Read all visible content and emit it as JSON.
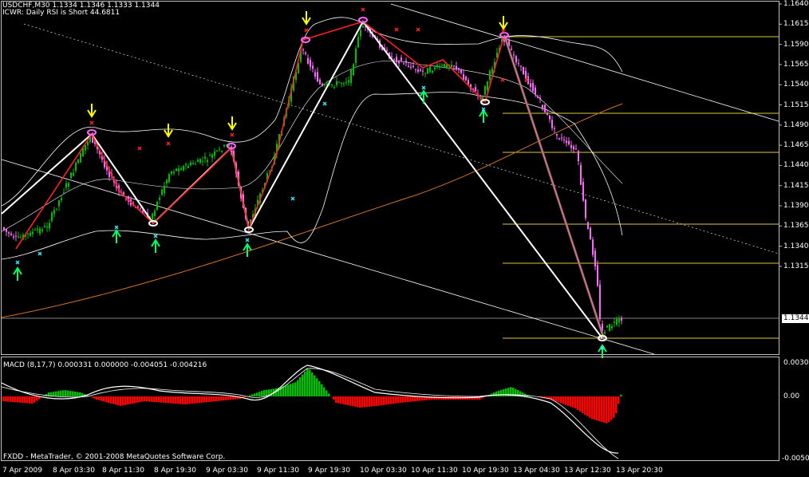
{
  "header": {
    "symbol_line": "USDCHF,M30  1.1334 1.1346 1.1333 1.1344",
    "indicator_line": "ICWR: Daily RSI is Short 44.6811"
  },
  "macd": {
    "label": "MACD  (8,17,7) 0.000331 0.000000 -0.004051 -0.004216",
    "axis": [
      "0.003036",
      "0.00",
      "-0.005087"
    ]
  },
  "footer": {
    "copyright": "FXDD - MetaTrader, © 2001-2008 MetaQuotes Software Corp."
  },
  "price_axis": [
    "1.1640",
    "1.1615",
    "1.1590",
    "1.1565",
    "1.1540",
    "1.1515",
    "1.1490",
    "1.1465",
    "1.1440",
    "1.1415",
    "1.1390",
    "1.1365",
    "1.1340",
    "1.1315"
  ],
  "current_price": "1.1344",
  "time_axis": [
    "7 Apr 2009",
    "8 Apr 03:30",
    "8 Apr 11:30",
    "8 Apr 19:30",
    "9 Apr 03:30",
    "9 Apr 11:30",
    "9 Apr 19:30",
    "10 Apr 03:30",
    "10 Apr 11:30",
    "10 Apr 19:30",
    "13 Apr 04:30",
    "13 Apr 12:30",
    "13 Apr 20:30"
  ],
  "colors": {
    "background": "#000000",
    "bull_candle": "#00c000",
    "bear_candle": "#ff66ff",
    "zigzag": "#ff2020",
    "trend_white": "#ffffff",
    "fib_line": "#d8c840",
    "ma_line": "#d07020",
    "macd_pos": "#00c000",
    "macd_neg": "#ff0000",
    "arrow_down": "#ffff00",
    "arrow_up": "#00ff60",
    "marker_x_red": "#ff2020",
    "marker_x_cyan": "#40e0ff"
  }
}
